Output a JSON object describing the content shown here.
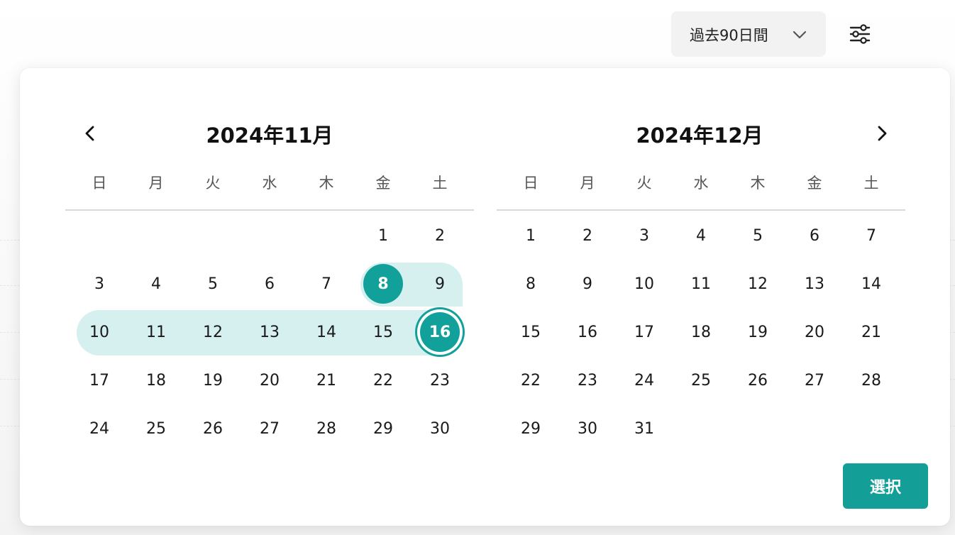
{
  "header": {
    "range_label": "過去90日間",
    "chevron_icon": "chevron-down-icon",
    "filter_icon": "sliders-icon"
  },
  "calendar": {
    "prev_icon": "chevron-left-icon",
    "next_icon": "chevron-right-icon",
    "selected_start": "2024-11-08",
    "selected_end": "2024-11-16",
    "accent_color": "#11a19a",
    "range_color": "#d6f0ef",
    "weekdays": [
      "日",
      "月",
      "火",
      "水",
      "木",
      "金",
      "土"
    ],
    "months": [
      {
        "title": "2024年11月",
        "first_weekday": 5,
        "days": [
          "1",
          "2",
          "3",
          "4",
          "5",
          "6",
          "7",
          "8",
          "9",
          "10",
          "11",
          "12",
          "13",
          "14",
          "15",
          "16",
          "17",
          "18",
          "19",
          "20",
          "21",
          "22",
          "23",
          "24",
          "25",
          "26",
          "27",
          "28",
          "29",
          "30"
        ]
      },
      {
        "title": "2024年12月",
        "first_weekday": 0,
        "days": [
          "1",
          "2",
          "3",
          "4",
          "5",
          "6",
          "7",
          "8",
          "9",
          "10",
          "11",
          "12",
          "13",
          "14",
          "15",
          "16",
          "17",
          "18",
          "19",
          "20",
          "21",
          "22",
          "23",
          "24",
          "25",
          "26",
          "27",
          "28",
          "29",
          "30",
          "31"
        ]
      }
    ]
  },
  "footer": {
    "select_label": "選択"
  }
}
